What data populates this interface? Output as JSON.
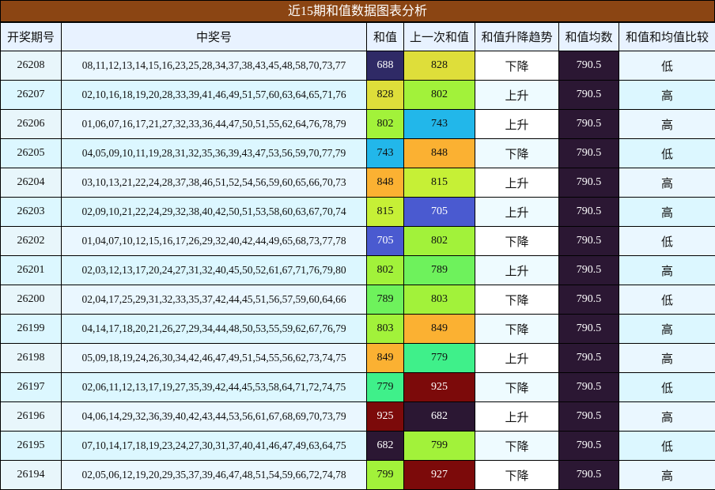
{
  "title": "近15期和值数据图表分析",
  "headers": [
    "开奖期号",
    "中奖号",
    "和值",
    "上一次和值",
    "和值升降趋势",
    "和值均数",
    "和值和均值比较"
  ],
  "rows": [
    {
      "period": "26208",
      "numbers": "08,11,12,13,14,15,16,23,25,28,34,37,38,43,45,48,58,70,73,77",
      "sum": "688",
      "sum_color": "#2f2a66",
      "sum_text_color": "#ffffff",
      "prev": "828",
      "prev_color": "#dede3a",
      "prev_text_color": "#111111",
      "trend": "下降",
      "avg": "790.5",
      "cmp": "低"
    },
    {
      "period": "26207",
      "numbers": "02,10,16,18,19,20,28,33,39,41,46,49,51,57,60,63,64,65,71,76",
      "sum": "828",
      "sum_color": "#dede3a",
      "sum_text_color": "#111111",
      "prev": "802",
      "prev_color": "#a2f23a",
      "prev_text_color": "#111111",
      "trend": "上升",
      "avg": "790.5",
      "cmp": "高"
    },
    {
      "period": "26206",
      "numbers": "01,06,07,16,17,21,27,32,33,36,44,47,50,51,55,62,64,76,78,79",
      "sum": "802",
      "sum_color": "#a2f23a",
      "sum_text_color": "#111111",
      "prev": "743",
      "prev_color": "#22b7ea",
      "prev_text_color": "#111111",
      "trend": "上升",
      "avg": "790.5",
      "cmp": "高"
    },
    {
      "period": "26205",
      "numbers": "04,05,09,10,11,19,28,31,32,35,36,39,43,47,53,56,59,70,77,79",
      "sum": "743",
      "sum_color": "#22b7ea",
      "sum_text_color": "#111111",
      "prev": "848",
      "prev_color": "#fbb132",
      "prev_text_color": "#111111",
      "trend": "下降",
      "avg": "790.5",
      "cmp": "低"
    },
    {
      "period": "26204",
      "numbers": "03,10,13,21,22,24,28,37,38,46,51,52,54,56,59,60,65,66,70,73",
      "sum": "848",
      "sum_color": "#fbb132",
      "sum_text_color": "#111111",
      "prev": "815",
      "prev_color": "#c6f036",
      "prev_text_color": "#111111",
      "trend": "上升",
      "avg": "790.5",
      "cmp": "高"
    },
    {
      "period": "26203",
      "numbers": "02,09,10,21,22,24,29,32,38,40,42,50,51,53,58,60,63,67,70,74",
      "sum": "815",
      "sum_color": "#c6f036",
      "sum_text_color": "#111111",
      "prev": "705",
      "prev_color": "#4a5ad0",
      "prev_text_color": "#ffffff",
      "trend": "上升",
      "avg": "790.5",
      "cmp": "高"
    },
    {
      "period": "26202",
      "numbers": "01,04,07,10,12,15,16,17,26,29,32,40,42,44,49,65,68,73,77,78",
      "sum": "705",
      "sum_color": "#4a5ad0",
      "sum_text_color": "#ffffff",
      "prev": "802",
      "prev_color": "#a2f23a",
      "prev_text_color": "#111111",
      "trend": "下降",
      "avg": "790.5",
      "cmp": "低"
    },
    {
      "period": "26201",
      "numbers": "02,03,12,13,17,20,24,27,31,32,40,45,50,52,61,67,71,76,79,80",
      "sum": "802",
      "sum_color": "#a2f23a",
      "sum_text_color": "#111111",
      "prev": "789",
      "prev_color": "#6ef25c",
      "prev_text_color": "#111111",
      "trend": "上升",
      "avg": "790.5",
      "cmp": "高"
    },
    {
      "period": "26200",
      "numbers": "02,04,17,25,29,31,32,33,35,37,42,44,45,51,56,57,59,60,64,66",
      "sum": "789",
      "sum_color": "#6ef25c",
      "sum_text_color": "#111111",
      "prev": "803",
      "prev_color": "#a2f23a",
      "prev_text_color": "#111111",
      "trend": "下降",
      "avg": "790.5",
      "cmp": "低"
    },
    {
      "period": "26199",
      "numbers": "04,14,17,18,20,21,26,27,29,34,44,48,50,53,55,59,62,67,76,79",
      "sum": "803",
      "sum_color": "#a2f23a",
      "sum_text_color": "#111111",
      "prev": "849",
      "prev_color": "#fbb132",
      "prev_text_color": "#111111",
      "trend": "下降",
      "avg": "790.5",
      "cmp": "高"
    },
    {
      "period": "26198",
      "numbers": "05,09,18,19,24,26,30,34,42,46,47,49,51,54,55,56,62,73,74,75",
      "sum": "849",
      "sum_color": "#fbb132",
      "sum_text_color": "#111111",
      "prev": "779",
      "prev_color": "#3ff08a",
      "prev_text_color": "#111111",
      "trend": "上升",
      "avg": "790.5",
      "cmp": "高"
    },
    {
      "period": "26197",
      "numbers": "02,06,11,12,13,17,19,27,35,39,42,44,45,53,58,64,71,72,74,75",
      "sum": "779",
      "sum_color": "#3ff08a",
      "sum_text_color": "#111111",
      "prev": "925",
      "prev_color": "#7c0a0a",
      "prev_text_color": "#ffffff",
      "trend": "下降",
      "avg": "790.5",
      "cmp": "低"
    },
    {
      "period": "26196",
      "numbers": "04,06,14,29,32,36,39,40,42,43,44,53,56,61,67,68,69,70,73,79",
      "sum": "925",
      "sum_color": "#7c0a0a",
      "sum_text_color": "#ffffff",
      "prev": "682",
      "prev_color": "#2b1733",
      "prev_text_color": "#ffffff",
      "trend": "上升",
      "avg": "790.5",
      "cmp": "高"
    },
    {
      "period": "26195",
      "numbers": "07,10,14,17,18,19,23,24,27,30,31,37,40,41,46,47,49,63,64,75",
      "sum": "682",
      "sum_color": "#2b1733",
      "sum_text_color": "#ffffff",
      "prev": "799",
      "prev_color": "#a2f23a",
      "prev_text_color": "#111111",
      "trend": "下降",
      "avg": "790.5",
      "cmp": "低"
    },
    {
      "period": "26194",
      "numbers": "02,05,06,12,19,20,29,35,37,39,46,47,48,51,54,59,66,72,74,78",
      "sum": "799",
      "sum_color": "#a2f23a",
      "sum_text_color": "#111111",
      "prev": "927",
      "prev_color": "#7c0a0a",
      "prev_text_color": "#ffffff",
      "trend": "下降",
      "avg": "790.5",
      "cmp": "高"
    }
  ]
}
